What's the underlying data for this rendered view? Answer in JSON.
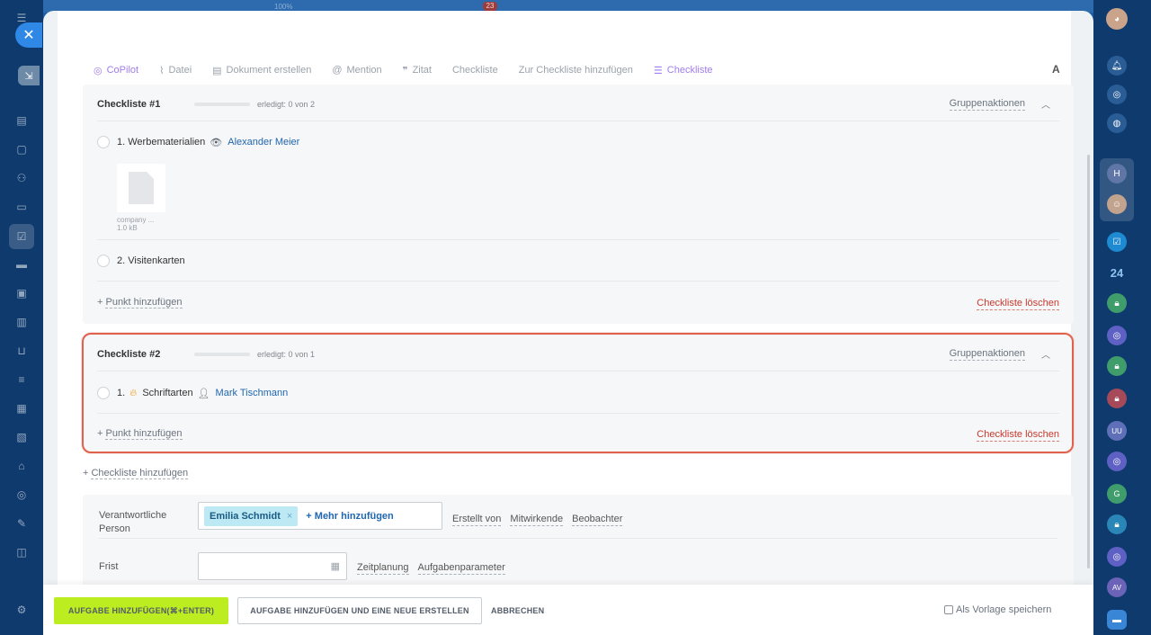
{
  "background": {
    "zoom_text": "100%",
    "badge_count": "23"
  },
  "right_rail": {
    "badge_24": "24",
    "avatar_initials": [
      "H",
      "G",
      "UU",
      "AV"
    ]
  },
  "toolbar": {
    "items": [
      {
        "label": "CoPilot",
        "icon": "copilot-icon"
      },
      {
        "label": "Datei",
        "icon": "paperclip-icon"
      },
      {
        "label": "Dokument erstellen",
        "icon": "document-icon"
      },
      {
        "label": "Mention",
        "icon": "at-icon"
      },
      {
        "label": "Zitat",
        "icon": "quote-icon"
      },
      {
        "label": "Checkliste",
        "icon": ""
      },
      {
        "label": "Zur Checkliste hinzufügen",
        "icon": ""
      },
      {
        "label": "Checkliste",
        "icon": "checklist-icon"
      }
    ],
    "font_button": "A"
  },
  "checklists": [
    {
      "title": "Checkliste #1",
      "progress_text": "erledigt: 0 von 2",
      "progress": 0,
      "group_actions": "Gruppenaktionen",
      "items": [
        {
          "number": "1.",
          "text": "Werbematerialien",
          "user": "Alexander Meier",
          "role_icon": "eye-icon"
        },
        {
          "number": "2.",
          "text": "Visitenkarten"
        }
      ],
      "file": {
        "name": "company ...",
        "size": "1.0 kB"
      },
      "add_point": "Punkt hinzufügen",
      "delete": "Checkliste löschen"
    },
    {
      "title": "Checkliste #2",
      "progress_text": "erledigt: 0 von 1",
      "progress": 0,
      "group_actions": "Gruppenaktionen",
      "items": [
        {
          "number": "1.",
          "text": "Schriftarten",
          "user": "Mark Tischmann",
          "role_icon": "person-icon",
          "flag_icon": "fire-icon"
        }
      ],
      "add_point": "Punkt hinzufügen",
      "delete": "Checkliste löschen"
    }
  ],
  "add_checklist": "Checkliste hinzufügen",
  "fields": {
    "responsible_label": "Verantwortliche Person",
    "responsible_user": "Emilia Schmidt",
    "add_more": "+ Mehr hinzufügen",
    "role_links": [
      "Erstellt von",
      "Mitwirkende",
      "Beobachter"
    ],
    "deadline_label": "Frist",
    "deadline_value": "",
    "deadline_links": [
      "Zeitplanung",
      "Aufgabenparameter"
    ]
  },
  "footer": {
    "primary": "AUFGABE HINZUFÜGEN(⌘+ENTER)",
    "secondary": "AUFGABE HINZUFÜGEN UND EINE NEUE ERSTELLEN",
    "cancel": "ABBRECHEN",
    "save_template": "Als Vorlage speichern"
  },
  "colors": {
    "accent_primary": "#bbed21",
    "highlight_outline": "#e0614d",
    "link_blue": "#2066b0",
    "delete_red": "#c63a2e",
    "copilot_purple": "#a07df0"
  }
}
